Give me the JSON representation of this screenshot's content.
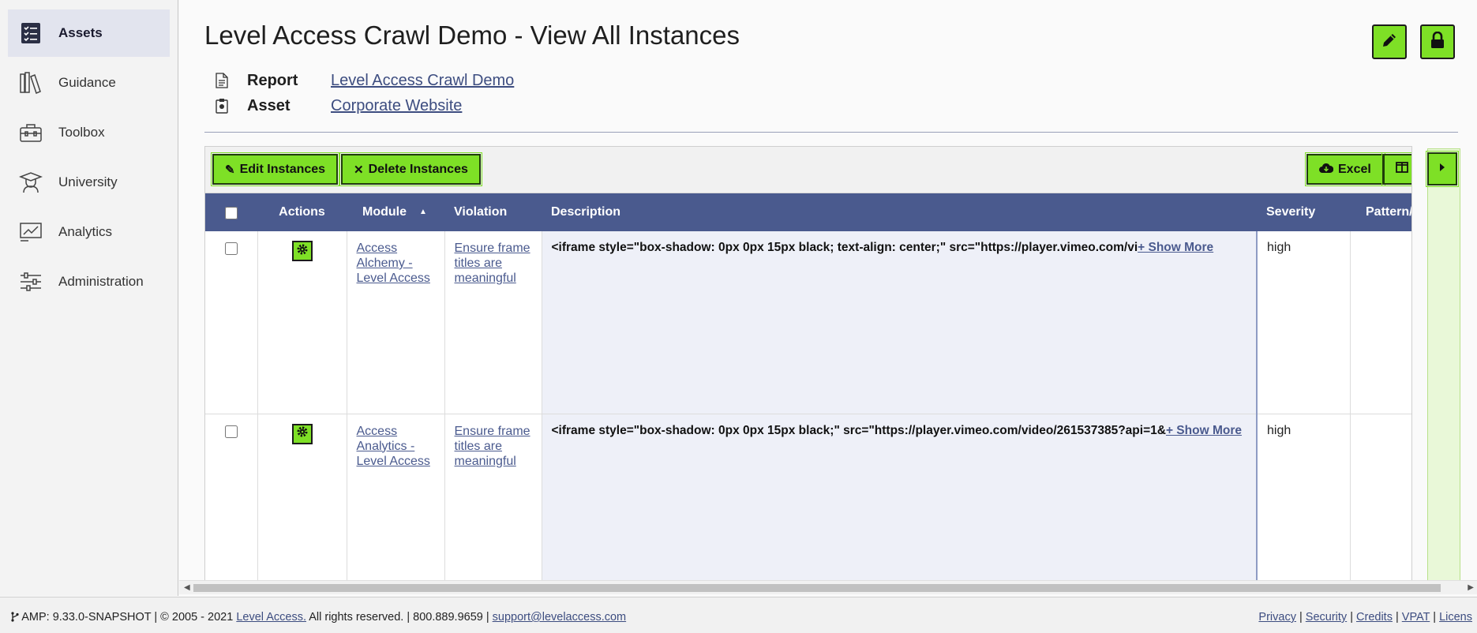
{
  "sidebar": {
    "items": [
      {
        "label": "Assets",
        "icon": "checklist-icon",
        "active": true
      },
      {
        "label": "Guidance",
        "icon": "books-icon"
      },
      {
        "label": "Toolbox",
        "icon": "toolbox-icon"
      },
      {
        "label": "University",
        "icon": "graduate-icon"
      },
      {
        "label": "Analytics",
        "icon": "analytics-icon"
      },
      {
        "label": "Administration",
        "icon": "sliders-icon"
      }
    ]
  },
  "header": {
    "title": "Level Access Crawl Demo - View All Instances",
    "report_key": "Report",
    "report_value": "Level Access Crawl Demo",
    "asset_key": "Asset",
    "asset_value": "Corporate Website"
  },
  "toolbar": {
    "edit_label": "Edit Instances",
    "delete_label": "Delete Instances",
    "excel_label": "Excel"
  },
  "table": {
    "columns": {
      "actions": "Actions",
      "module": "Module",
      "violation": "Violation",
      "description": "Description",
      "severity": "Severity",
      "pattern": "Pattern/("
    },
    "rows": [
      {
        "module": "Access Alchemy - Level Access",
        "violation": "Ensure frame titles are meaningful",
        "description": "<iframe style=\"box-shadow: 0px 0px 15px black; text-align: center;\" src=\"https://player.vimeo.com/vi",
        "show_more": "+ Show More",
        "severity": "high"
      },
      {
        "module": "Access Analytics - Level Access",
        "violation": "Ensure frame titles are meaningful",
        "description": "<iframe style=\"box-shadow: 0px 0px 15px black;\" src=\"https://player.vimeo.com/video/261537385?api=1&",
        "show_more": "+ Show More",
        "severity": "high"
      }
    ]
  },
  "footer": {
    "version": "AMP: 9.33.0-SNAPSHOT | © 2005 - 2021 ",
    "company_link": "Level Access.",
    "rights": " All rights reserved. | 800.889.9659 | ",
    "email": "support@levelaccess.com",
    "links": [
      "Privacy",
      "Security",
      "Credits",
      "VPAT",
      "Licens"
    ]
  },
  "colors": {
    "accent_green": "#7ee026",
    "header_blue": "#4a5a8e",
    "link": "#3d4d80"
  }
}
